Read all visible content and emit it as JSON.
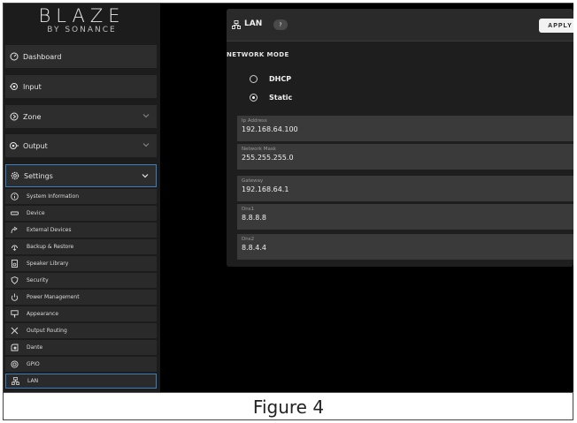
{
  "logo": {
    "main": "BLAZE",
    "sub": "BY SONANCE"
  },
  "sidebar": {
    "items": [
      {
        "label": "Dashboard",
        "icon": "dashboard-icon"
      },
      {
        "label": "Input",
        "icon": "input-icon"
      },
      {
        "label": "Zone",
        "icon": "zone-icon"
      },
      {
        "label": "Output",
        "icon": "output-icon"
      },
      {
        "label": "Settings",
        "icon": "settings-icon"
      }
    ],
    "settings_items": [
      {
        "label": "System Information",
        "icon": "info-icon"
      },
      {
        "label": "Device",
        "icon": "device-icon"
      },
      {
        "label": "External Devices",
        "icon": "external-devices-icon"
      },
      {
        "label": "Backup & Restore",
        "icon": "backup-restore-icon"
      },
      {
        "label": "Speaker Library",
        "icon": "speaker-library-icon"
      },
      {
        "label": "Security",
        "icon": "shield-icon"
      },
      {
        "label": "Power Management",
        "icon": "power-icon"
      },
      {
        "label": "Appearance",
        "icon": "appearance-icon"
      },
      {
        "label": "Output Routing",
        "icon": "routing-icon"
      },
      {
        "label": "Dante",
        "icon": "dante-icon"
      },
      {
        "label": "GPIO",
        "icon": "gpio-icon"
      },
      {
        "label": "LAN",
        "icon": "network-icon"
      }
    ]
  },
  "panel": {
    "title": "LAN",
    "help": "?",
    "apply": "APPLY",
    "section": "NETWORK MODE",
    "modes": [
      {
        "label": "DHCP",
        "checked": false
      },
      {
        "label": "Static",
        "checked": true
      }
    ],
    "fields": [
      {
        "label": "Ip Address",
        "value": "192.168.64.100"
      },
      {
        "label": "Network Mask",
        "value": "255.255.255.0"
      },
      {
        "label": "Gateway",
        "value": "192.168.64.1"
      },
      {
        "label": "Dns1",
        "value": "8.8.8.8"
      },
      {
        "label": "Dns2",
        "value": "8.8.4.4"
      }
    ]
  },
  "caption": "Figure 4",
  "colors": {
    "accent": "#3b7fbf",
    "background": "#000000",
    "sidebar": "#1c1c1c"
  }
}
